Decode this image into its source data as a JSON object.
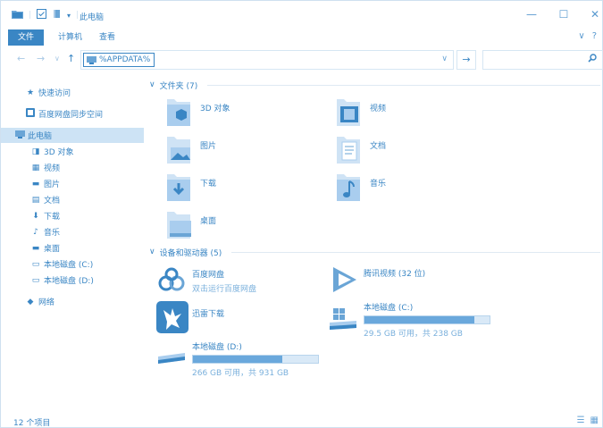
{
  "titlebar": {
    "title": "此电脑",
    "minimize": "—",
    "maximize": "☐",
    "close": "✕"
  },
  "ribbon": {
    "tabs": [
      "文件",
      "计算机",
      "查看"
    ],
    "expand_icon": "∨",
    "help_icon": "?"
  },
  "address": {
    "value": "%APPDATA%",
    "back": "←",
    "forward": "→",
    "recent": "∨",
    "up": "↑",
    "dropdown": "∨",
    "go": "→",
    "search_icon": "⚲"
  },
  "nav": {
    "items": [
      {
        "label": "快速访问",
        "icon": "star-icon"
      },
      {
        "label": "百度网盘同步空间",
        "icon": "baidu-sync-icon"
      },
      {
        "label": "此电脑",
        "icon": "computer-icon"
      },
      {
        "label": "3D 对象",
        "icon": "3d-objects-icon"
      },
      {
        "label": "视频",
        "icon": "video-icon"
      },
      {
        "label": "图片",
        "icon": "pictures-icon"
      },
      {
        "label": "文档",
        "icon": "documents-icon"
      },
      {
        "label": "下载",
        "icon": "downloads-icon"
      },
      {
        "label": "音乐",
        "icon": "music-icon"
      },
      {
        "label": "桌面",
        "icon": "desktop-icon"
      },
      {
        "label": "本地磁盘 (C:)",
        "icon": "drive-icon"
      },
      {
        "label": "本地磁盘 (D:)",
        "icon": "drive-icon"
      },
      {
        "label": "网络",
        "icon": "network-icon"
      }
    ],
    "selected": "此电脑"
  },
  "content": {
    "folders_header": "文件夹 (7)",
    "folders": [
      {
        "label": "3D 对象",
        "icon": "3d-objects-folder-icon"
      },
      {
        "label": "视频",
        "icon": "video-folder-icon"
      },
      {
        "label": "图片",
        "icon": "pictures-folder-icon"
      },
      {
        "label": "文档",
        "icon": "documents-folder-icon"
      },
      {
        "label": "下载",
        "icon": "downloads-folder-icon"
      },
      {
        "label": "音乐",
        "icon": "music-folder-icon"
      },
      {
        "label": "桌面",
        "icon": "desktop-folder-icon"
      }
    ],
    "devices_header": "设备和驱动器 (5)",
    "devices": [
      {
        "label": "百度网盘",
        "sub": "双击运行百度网盘",
        "icon": "baidu-netdisk-icon"
      },
      {
        "label": "腾讯视频 (32 位)",
        "sub": "",
        "icon": "tencent-video-icon"
      },
      {
        "label": "迅雷下载",
        "sub": "",
        "icon": "xunlei-icon"
      },
      {
        "label": "本地磁盘 (C:)",
        "sub": "29.5 GB 可用，共 238 GB",
        "icon": "windows-drive-icon",
        "used_fraction": 0.876
      },
      {
        "label": "本地磁盘 (D:)",
        "sub": "266 GB 可用，共 931 GB",
        "icon": "drive-icon",
        "used_fraction": 0.714
      }
    ]
  },
  "status": {
    "count": "12 个项目"
  },
  "colors": {
    "accent": "#3a86c4",
    "selection": "#cde3f5",
    "bar_fill": "#6aa8dc",
    "bar_bg": "#d9e9f7"
  }
}
